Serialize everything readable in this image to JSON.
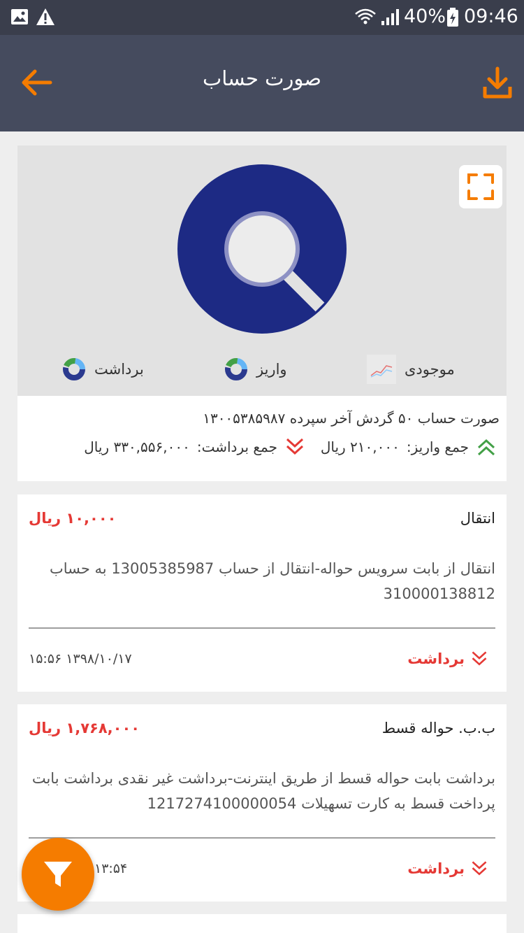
{
  "status_bar": {
    "battery": "40%",
    "time": "09:46"
  },
  "app_bar": {
    "title": "صورت حساب"
  },
  "chart": {
    "legend": [
      {
        "label": "موجودی",
        "icon": "line-chart-icon"
      },
      {
        "label": "واریز",
        "icon": "donut-chart-icon"
      },
      {
        "label": "برداشت",
        "icon": "donut-chart-icon"
      }
    ],
    "colors": {
      "donut": "#1d2a84",
      "hole_ring": "#8d91c4",
      "hole": "#ececec"
    }
  },
  "summary": {
    "line": "صورت حساب ۵۰ گردش آخر سپرده  ۱۳۰۰۵۳۸۵۹۸۷",
    "deposit_label": "جمع واریز:",
    "deposit_value": "۲۱۰,۰۰۰ ریال",
    "withdraw_label": "جمع برداشت:",
    "withdraw_value": "۳۳۰,۵۵۶,۰۰۰ ریال"
  },
  "transactions": [
    {
      "title": "انتقال",
      "amount": "۱۰,۰۰۰  ریال",
      "description": "انتقال از بابت سرویس حواله-انتقال از حساب 13005385987 به حساب 310000138812",
      "type": "برداشت",
      "datetime": "۱۳۹۸/۱۰/۱۷  ۱۵:۵۶"
    },
    {
      "title": "ب.ب. حواله قسط",
      "amount": "۱,۷۶۸,۰۰۰  ریال",
      "description": "برداشت بابت حواله قسط از طریق اینترنت-برداشت غیر نقدی برداشت بابت پرداخت قسط به کارت تسهیلات 1217274100000054",
      "type": "برداشت",
      "datetime": "۱۳:۵۴"
    }
  ],
  "colors": {
    "accent": "#f57c00",
    "withdraw": "#e53935",
    "deposit": "#43a047",
    "header": "#454b5e"
  }
}
